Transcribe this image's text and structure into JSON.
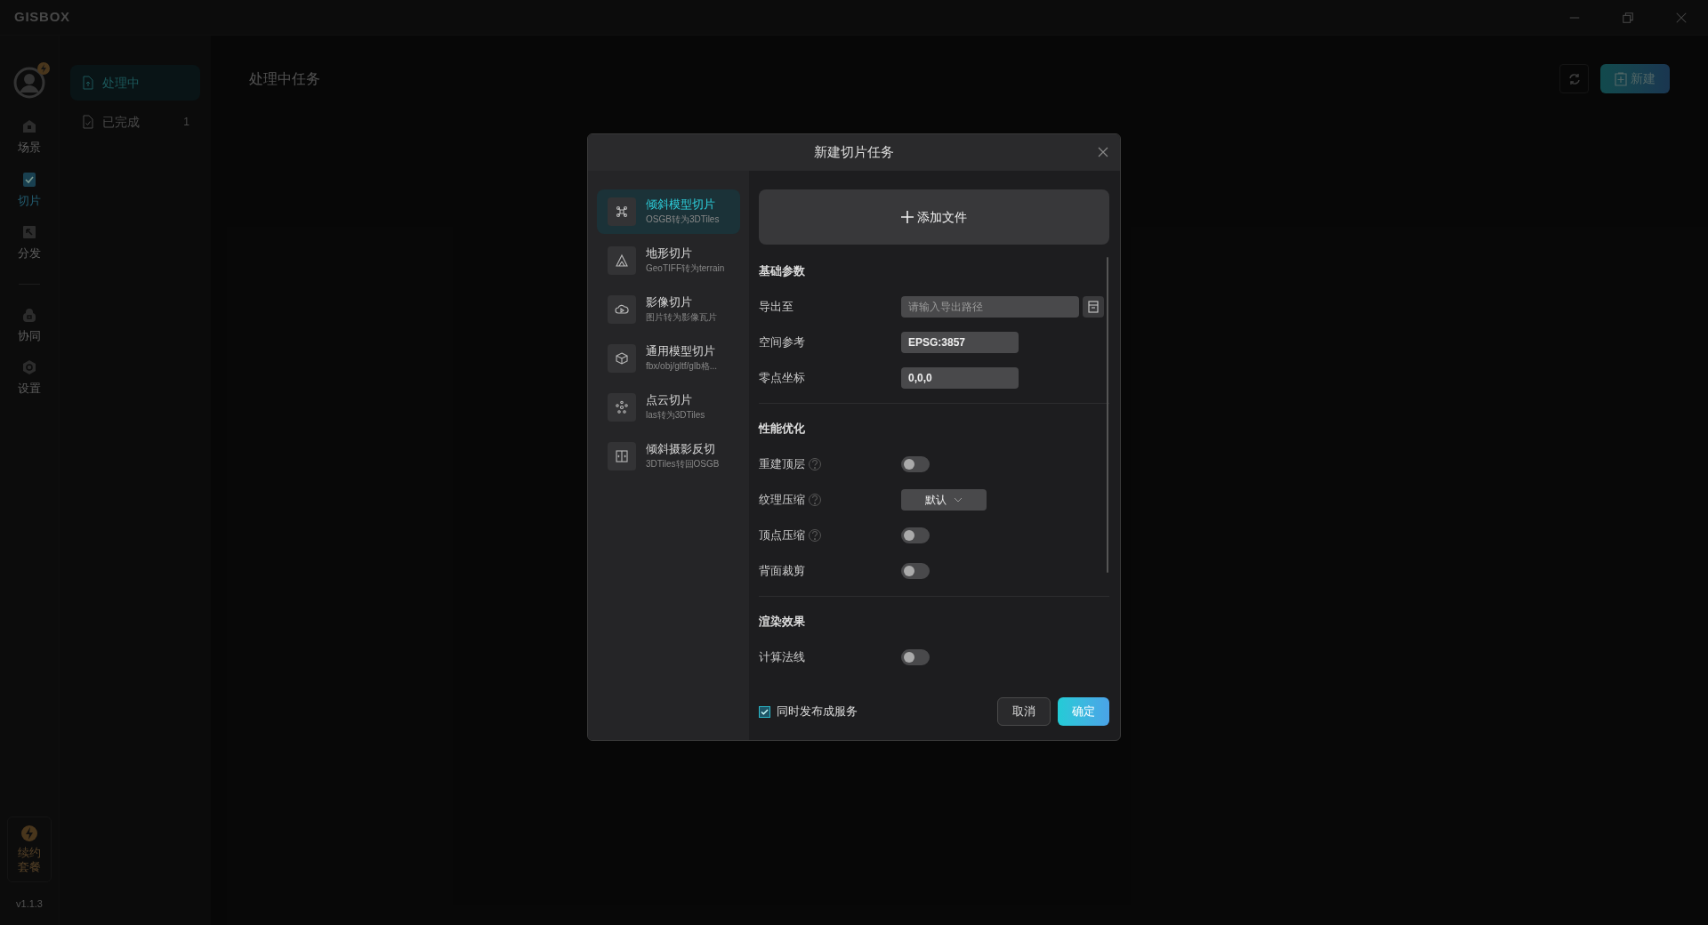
{
  "app": {
    "logo": "GISBOX"
  },
  "nav": {
    "items": [
      {
        "label": "场景",
        "selected": false
      },
      {
        "label": "切片",
        "selected": true
      },
      {
        "label": "分发",
        "selected": false
      },
      {
        "label": "协同",
        "selected": false
      },
      {
        "label": "设置",
        "selected": false
      }
    ],
    "renew": "续约套餐",
    "version": "v1.1.3"
  },
  "task_tabs": [
    {
      "label": "处理中",
      "selected": true
    },
    {
      "label": "已完成",
      "selected": false,
      "count": "1"
    }
  ],
  "main": {
    "title": "处理中任务",
    "new_button": "新建"
  },
  "dialog": {
    "title": "新建切片任务",
    "types": [
      {
        "title": "倾斜模型切片",
        "subtitle": "OSGB转为3DTiles",
        "selected": true
      },
      {
        "title": "地形切片",
        "subtitle": "GeoTIFF转为terrain",
        "selected": false
      },
      {
        "title": "影像切片",
        "subtitle": "图片转为影像瓦片",
        "selected": false
      },
      {
        "title": "通用模型切片",
        "subtitle": "fbx/obj/gltf/glb格...",
        "selected": false
      },
      {
        "title": "点云切片",
        "subtitle": "las转为3DTiles",
        "selected": false
      },
      {
        "title": "倾斜摄影反切",
        "subtitle": "3DTiles转回OSGB",
        "selected": false
      }
    ],
    "add_file": "添加文件",
    "sections": [
      {
        "title": "基础参数",
        "rows": [
          {
            "kind": "path",
            "label": "导出至",
            "placeholder": "请输入导出路径"
          },
          {
            "kind": "input",
            "label": "空间参考",
            "value": "EPSG:3857"
          },
          {
            "kind": "input",
            "label": "零点坐标",
            "value": "0,0,0"
          }
        ]
      },
      {
        "title": "性能优化",
        "rows": [
          {
            "kind": "toggle",
            "label": "重建顶层",
            "help": true,
            "on": false
          },
          {
            "kind": "select",
            "label": "纹理压缩",
            "help": true,
            "value": "默认"
          },
          {
            "kind": "toggle",
            "label": "顶点压缩",
            "help": true,
            "on": false
          },
          {
            "kind": "toggle",
            "label": "背面裁剪",
            "help": false,
            "on": false
          }
        ]
      },
      {
        "title": "渲染效果",
        "rows": [
          {
            "kind": "toggle",
            "label": "计算法线",
            "help": false,
            "on": false
          }
        ]
      }
    ],
    "publish": {
      "label": "同时发布成服务",
      "checked": true
    },
    "cancel": "取消",
    "confirm": "确定"
  }
}
